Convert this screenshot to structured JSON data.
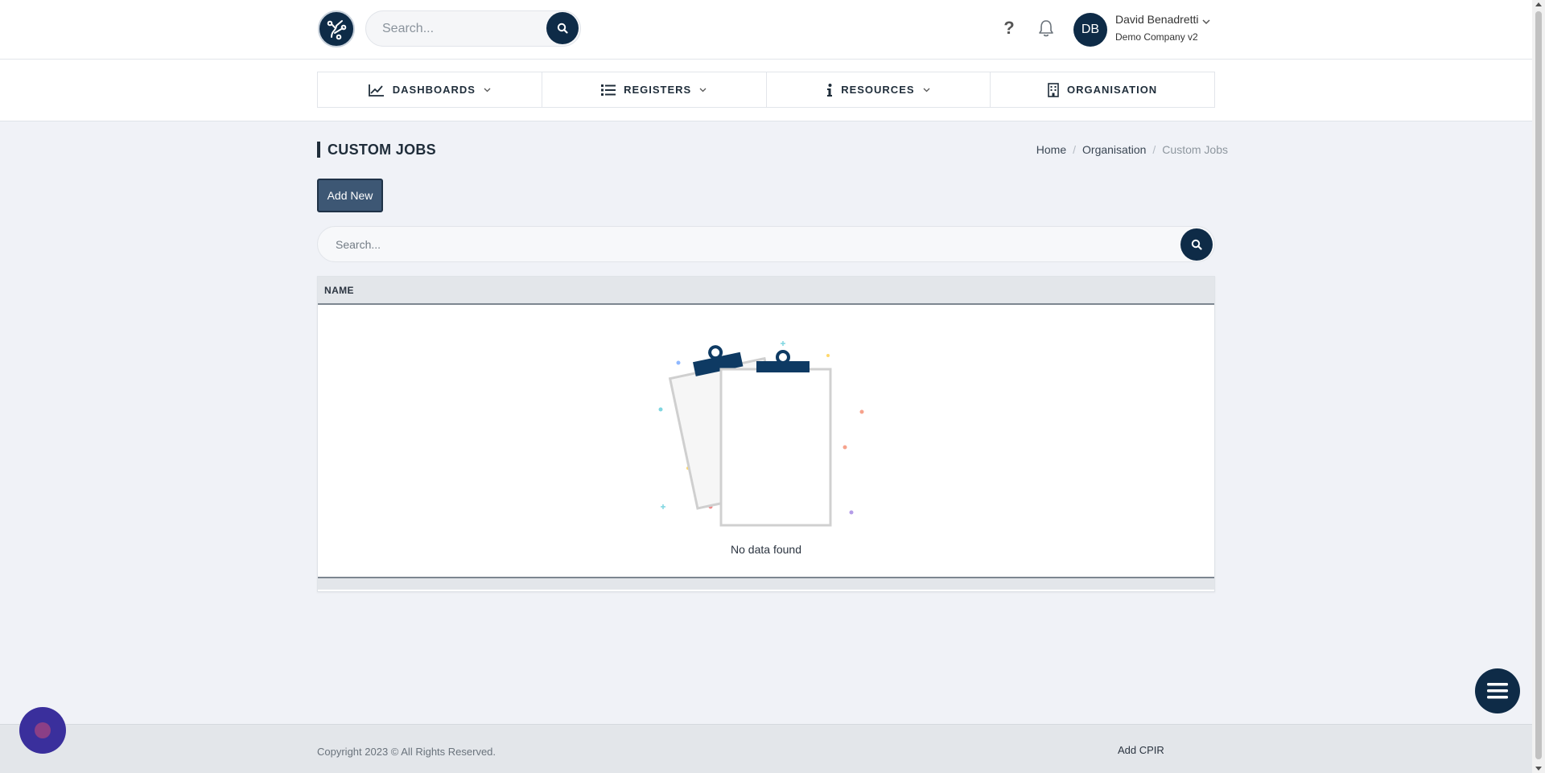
{
  "header": {
    "search_placeholder": "Search...",
    "help_label": "?",
    "user": {
      "initials": "DB",
      "name": "David Benadretti",
      "company": "Demo Company v2"
    }
  },
  "nav": {
    "items": [
      {
        "label": "DASHBOARDS",
        "icon": "chart-line-icon",
        "has_dropdown": true
      },
      {
        "label": "REGISTERS",
        "icon": "list-icon",
        "has_dropdown": true
      },
      {
        "label": "RESOURCES",
        "icon": "info-icon",
        "has_dropdown": true
      },
      {
        "label": "ORGANISATION",
        "icon": "building-icon",
        "has_dropdown": false
      }
    ]
  },
  "page": {
    "title": "CUSTOM JOBS",
    "breadcrumb": [
      "Home",
      "Organisation",
      "Custom Jobs"
    ],
    "breadcrumb_separator": "/",
    "add_button": "Add New",
    "search_placeholder": "Search..."
  },
  "table": {
    "columns": [
      "NAME"
    ],
    "rows": [],
    "empty_message": "No data found"
  },
  "footer": {
    "copyright": "Copyright 2023 © All Rights Reserved.",
    "add_cpir": "Add CPIR"
  },
  "colors": {
    "brand_navy": "#0e2b47",
    "button_primary": "#3d5774",
    "page_background": "#f0f2f7",
    "chat_widget": "#3a2f9c"
  }
}
